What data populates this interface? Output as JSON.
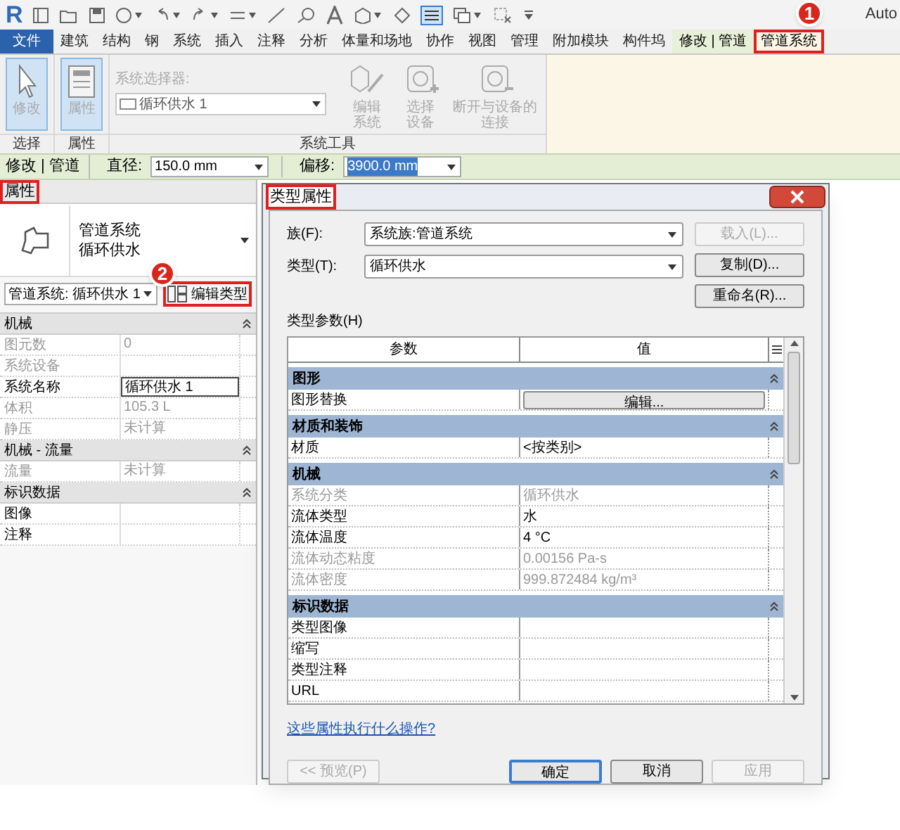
{
  "app": {
    "logo": "R",
    "title_fragment": "Auto"
  },
  "ribbon_tabs": [
    {
      "label": "文件",
      "kind": "file",
      "selected": false,
      "highlighted": false
    },
    {
      "label": "建筑",
      "kind": "normal",
      "selected": false,
      "highlighted": false
    },
    {
      "label": "结构",
      "kind": "normal",
      "selected": false,
      "highlighted": false
    },
    {
      "label": "钢",
      "kind": "normal",
      "selected": false,
      "highlighted": false
    },
    {
      "label": "系统",
      "kind": "normal",
      "selected": false,
      "highlighted": false
    },
    {
      "label": "插入",
      "kind": "normal",
      "selected": false,
      "highlighted": false
    },
    {
      "label": "注释",
      "kind": "normal",
      "selected": false,
      "highlighted": false
    },
    {
      "label": "分析",
      "kind": "normal",
      "selected": false,
      "highlighted": false
    },
    {
      "label": "体量和场地",
      "kind": "normal",
      "selected": false,
      "highlighted": false
    },
    {
      "label": "协作",
      "kind": "normal",
      "selected": false,
      "highlighted": false
    },
    {
      "label": "视图",
      "kind": "normal",
      "selected": false,
      "highlighted": false
    },
    {
      "label": "管理",
      "kind": "normal",
      "selected": false,
      "highlighted": false
    },
    {
      "label": "附加模块",
      "kind": "normal",
      "selected": false,
      "highlighted": false
    },
    {
      "label": "构件坞",
      "kind": "normal",
      "selected": false,
      "highlighted": false
    },
    {
      "label": "修改 | 管道",
      "kind": "contextual",
      "selected": false,
      "highlighted": false
    },
    {
      "label": "管道系统",
      "kind": "contextual",
      "selected": true,
      "highlighted": true
    }
  ],
  "ribbon": {
    "panels": [
      {
        "label": "选择",
        "buttons": [
          {
            "lines": [
              "修改"
            ],
            "kind": "pointer"
          }
        ]
      },
      {
        "label": "属性",
        "buttons": [
          {
            "lines": [
              "属性"
            ],
            "kind": "properties"
          }
        ]
      },
      {
        "label": "系统工具",
        "selector_label": "系统选择器:",
        "selector_value": "循环供水 1",
        "buttons": [
          {
            "lines": [
              "编辑",
              "系统"
            ],
            "kind": "edit"
          },
          {
            "lines": [
              "选择",
              "设备"
            ],
            "kind": "add"
          },
          {
            "lines": [
              "断开与设备的",
              "连接"
            ],
            "kind": "remove"
          }
        ]
      }
    ]
  },
  "options_bar": {
    "context": "修改 | 管道",
    "fields": [
      {
        "label": "直径:",
        "value": "150.0 mm",
        "selected": false
      },
      {
        "label": "偏移:",
        "value": "3900.0 mm",
        "selected": true
      }
    ]
  },
  "properties": {
    "title": "属性",
    "title_highlighted": true,
    "type_lines": [
      "管道系统",
      "循环供水"
    ],
    "selector": "管道系统: 循环供水 1",
    "edit_type_button": {
      "label": "编辑类型",
      "highlighted": true
    },
    "groups": [
      {
        "name": "机械",
        "rows": [
          {
            "param": "图元数",
            "value": "0",
            "editable": false
          },
          {
            "param": "系统设备",
            "value": "",
            "editable": false
          },
          {
            "param": "系统名称",
            "value": "循环供水 1",
            "editable": true
          },
          {
            "param": "体积",
            "value": "105.3 L",
            "editable": false
          },
          {
            "param": "静压",
            "value": "未计算",
            "editable": false
          }
        ]
      },
      {
        "name": "机械 - 流量",
        "rows": [
          {
            "param": "流量",
            "value": "未计算",
            "editable": false
          }
        ]
      },
      {
        "name": "标识数据",
        "rows": [
          {
            "param": "图像",
            "value": "",
            "editable": true
          },
          {
            "param": "注释",
            "value": "",
            "editable": true
          }
        ]
      }
    ]
  },
  "dialog": {
    "title": "类型属性",
    "title_highlighted": true,
    "fields": [
      {
        "label": "族(F):",
        "value": "系统族:管道系统"
      },
      {
        "label": "类型(T):",
        "value": "循环供水"
      }
    ],
    "side_buttons": [
      {
        "label": "载入(L)...",
        "disabled": true
      },
      {
        "label": "复制(D)...",
        "disabled": false
      },
      {
        "label": "重命名(R)...",
        "disabled": false
      }
    ],
    "params_label": "类型参数(H)",
    "columns": [
      "参数",
      "值"
    ],
    "groups": [
      {
        "name": "图形",
        "rows": [
          {
            "param": "图形替换",
            "value": "编辑...",
            "kind": "button",
            "editable": true
          }
        ]
      },
      {
        "name": "材质和装饰",
        "rows": [
          {
            "param": "材质",
            "value": "<按类别>",
            "kind": "text",
            "editable": true
          }
        ]
      },
      {
        "name": "机械",
        "rows": [
          {
            "param": "系统分类",
            "value": "循环供水",
            "kind": "text",
            "editable": false
          },
          {
            "param": "流体类型",
            "value": "水",
            "kind": "text",
            "editable": true
          },
          {
            "param": "流体温度",
            "value": "4 °C",
            "kind": "text",
            "editable": true
          },
          {
            "param": "流体动态粘度",
            "value": "0.00156 Pa-s",
            "kind": "text",
            "editable": false
          },
          {
            "param": "流体密度",
            "value": "999.872484 kg/m³",
            "kind": "text",
            "editable": false
          }
        ]
      },
      {
        "name": "标识数据",
        "rows": [
          {
            "param": "类型图像",
            "value": "",
            "kind": "text",
            "editable": true
          },
          {
            "param": "缩写",
            "value": "",
            "kind": "text",
            "editable": true
          },
          {
            "param": "类型注释",
            "value": "",
            "kind": "text",
            "editable": true
          },
          {
            "param": "URL",
            "value": "",
            "kind": "text",
            "editable": true
          }
        ]
      }
    ],
    "help_link": "这些属性执行什么操作?",
    "buttons": [
      {
        "label": "<< 预览(P)",
        "disabled": true,
        "default": false
      },
      {
        "label": "确定",
        "disabled": false,
        "default": true
      },
      {
        "label": "取消",
        "disabled": false,
        "default": false
      },
      {
        "label": "应用",
        "disabled": true,
        "default": false
      }
    ]
  },
  "callouts": [
    {
      "number": "1"
    },
    {
      "number": "2"
    }
  ]
}
